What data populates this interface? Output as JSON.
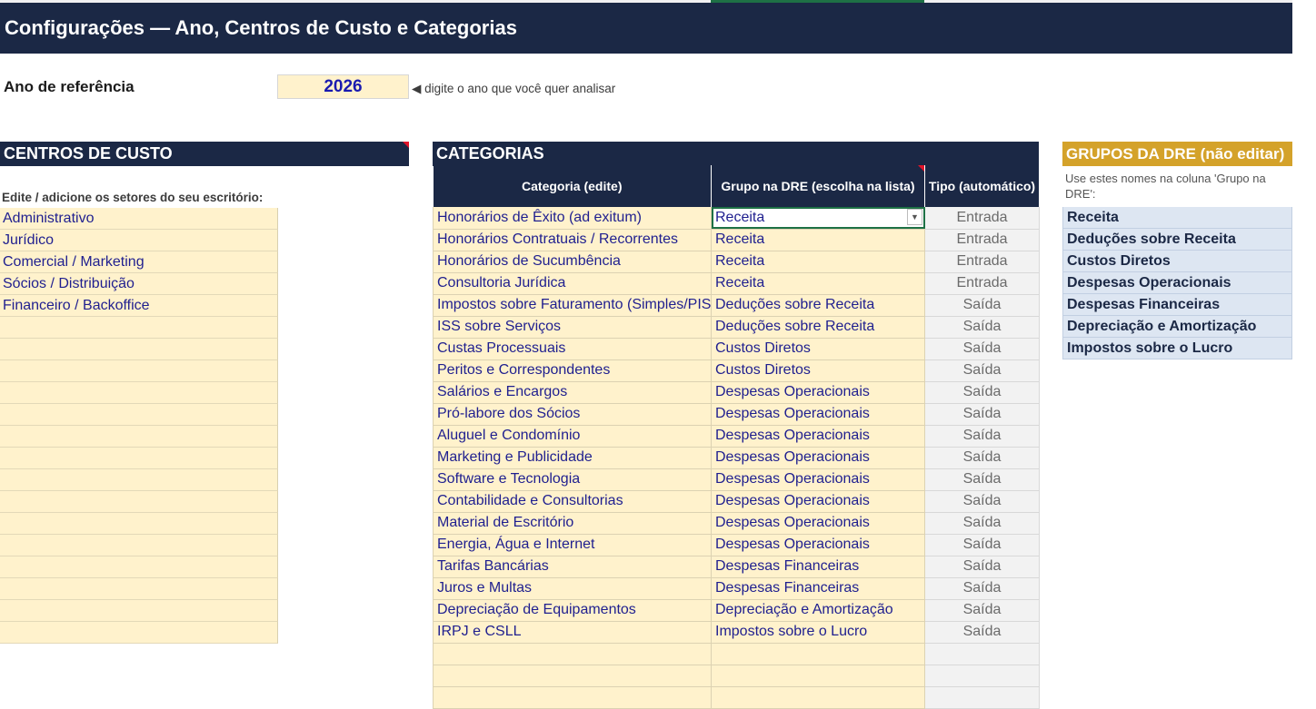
{
  "title": "Configurações — Ano, Centros de Custo e Categorias",
  "year": {
    "label": "Ano de referência",
    "value": "2026",
    "hint": "◀ digite o ano que você quer analisar"
  },
  "cost_centers": {
    "header": "CENTROS DE CUSTO",
    "instruction": "Edite / adicione os setores do seu escritório:",
    "items": [
      "Administrativo",
      "Jurídico",
      "Comercial / Marketing",
      "Sócios / Distribuição",
      "Financeiro / Backoffice",
      "",
      "",
      "",
      "",
      "",
      "",
      "",
      "",
      "",
      "",
      "",
      "",
      "",
      "",
      ""
    ]
  },
  "categories": {
    "header": "CATEGORIAS",
    "columns": [
      "Categoria (edite)",
      "Grupo na DRE (escolha na lista)",
      "Tipo (automático)"
    ],
    "rows": [
      {
        "categoria": "Honorários de Êxito (ad exitum)",
        "grupo": "Receita",
        "tipo": "Entrada"
      },
      {
        "categoria": "Honorários Contratuais / Recorrentes",
        "grupo": "Receita",
        "tipo": "Entrada"
      },
      {
        "categoria": "Honorários de Sucumbência",
        "grupo": "Receita",
        "tipo": "Entrada"
      },
      {
        "categoria": "Consultoria Jurídica",
        "grupo": "Receita",
        "tipo": "Entrada"
      },
      {
        "categoria": "Impostos sobre Faturamento (Simples/PIS",
        "grupo": "Deduções sobre Receita",
        "tipo": "Saída"
      },
      {
        "categoria": "ISS sobre Serviços",
        "grupo": "Deduções sobre Receita",
        "tipo": "Saída"
      },
      {
        "categoria": "Custas Processuais",
        "grupo": "Custos Diretos",
        "tipo": "Saída"
      },
      {
        "categoria": "Peritos e Correspondentes",
        "grupo": "Custos Diretos",
        "tipo": "Saída"
      },
      {
        "categoria": "Salários e Encargos",
        "grupo": "Despesas Operacionais",
        "tipo": "Saída"
      },
      {
        "categoria": "Pró-labore dos Sócios",
        "grupo": "Despesas Operacionais",
        "tipo": "Saída"
      },
      {
        "categoria": "Aluguel e Condomínio",
        "grupo": "Despesas Operacionais",
        "tipo": "Saída"
      },
      {
        "categoria": "Marketing e Publicidade",
        "grupo": "Despesas Operacionais",
        "tipo": "Saída"
      },
      {
        "categoria": "Software e Tecnologia",
        "grupo": "Despesas Operacionais",
        "tipo": "Saída"
      },
      {
        "categoria": "Contabilidade e Consultorias",
        "grupo": "Despesas Operacionais",
        "tipo": "Saída"
      },
      {
        "categoria": "Material de Escritório",
        "grupo": "Despesas Operacionais",
        "tipo": "Saída"
      },
      {
        "categoria": "Energia, Água e Internet",
        "grupo": "Despesas Operacionais",
        "tipo": "Saída"
      },
      {
        "categoria": "Tarifas Bancárias",
        "grupo": "Despesas Financeiras",
        "tipo": "Saída"
      },
      {
        "categoria": "Juros e Multas",
        "grupo": "Despesas Financeiras",
        "tipo": "Saída"
      },
      {
        "categoria": "Depreciação de Equipamentos",
        "grupo": "Depreciação e Amortização",
        "tipo": "Saída"
      },
      {
        "categoria": "IRPJ e CSLL",
        "grupo": "Impostos sobre o Lucro",
        "tipo": "Saída"
      },
      {
        "categoria": "",
        "grupo": "",
        "tipo": ""
      },
      {
        "categoria": "",
        "grupo": "",
        "tipo": ""
      },
      {
        "categoria": "",
        "grupo": "",
        "tipo": ""
      }
    ]
  },
  "dre_groups": {
    "header": "GRUPOS DA DRE (não editar)",
    "hint": "Use estes nomes na coluna 'Grupo na DRE':",
    "items": [
      "Receita",
      "Deduções sobre Receita",
      "Custos Diretos",
      "Despesas Operacionais",
      "Despesas Financeiras",
      "Depreciação e Amortização",
      "Impostos sobre o Lucro"
    ]
  },
  "icons": {
    "dropdown": "chevron-down-icon"
  },
  "colors": {
    "header_navy": "#1b2845",
    "input_yellow": "#fff2cc",
    "dre_gold": "#d4a22a",
    "dre_blue": "#dde6f2",
    "selection_green": "#1e7145"
  }
}
